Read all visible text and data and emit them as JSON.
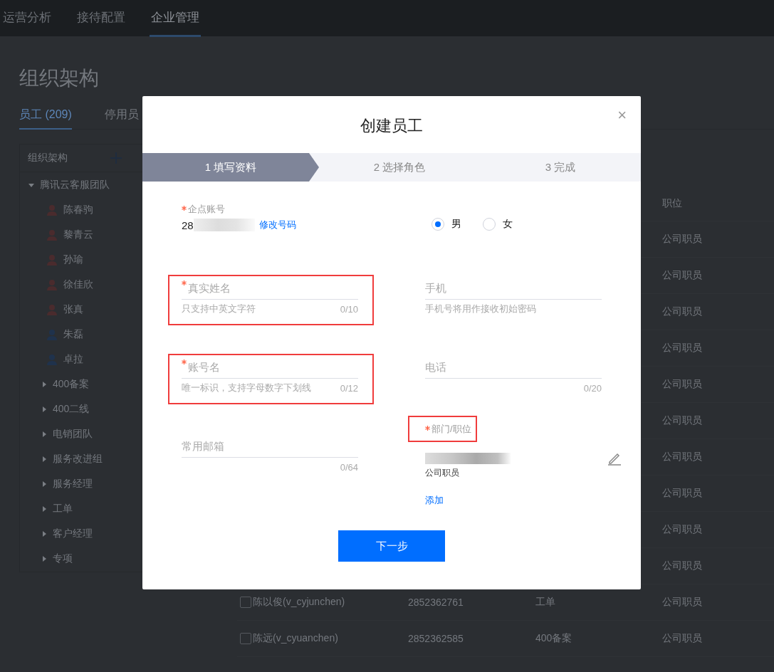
{
  "top_nav": {
    "items": [
      {
        "label": "运营分析",
        "selected": false
      },
      {
        "label": "接待配置",
        "selected": false
      },
      {
        "label": "企业管理",
        "selected": true
      }
    ]
  },
  "page_title": "组织架构",
  "tabs": [
    {
      "label": "员工 (209)",
      "selected": true
    },
    {
      "label": "停用员",
      "selected": false
    }
  ],
  "tree": {
    "header": "组织架构",
    "items": [
      {
        "label": "腾讯云客服团队",
        "expanded": true,
        "children": [
          {
            "kind": "person",
            "label": "陈春驹",
            "color": "#4a2b2d"
          },
          {
            "kind": "person",
            "label": "黎青云",
            "color": "#4a2b2d"
          },
          {
            "kind": "person",
            "label": "孙瑜",
            "color": "#4a2b2d"
          },
          {
            "kind": "person",
            "label": "徐佳欣",
            "color": "#4a2b2d"
          },
          {
            "kind": "person",
            "label": "张真",
            "color": "#4a2b2d"
          },
          {
            "kind": "person",
            "label": "朱磊",
            "color": "#1f324c"
          },
          {
            "kind": "person",
            "label": "卓拉",
            "color": "#1f324c"
          },
          {
            "kind": "group",
            "label": "400备案",
            "expanded": false
          },
          {
            "kind": "group",
            "label": "400二线",
            "expanded": false
          },
          {
            "kind": "group",
            "label": "电销团队",
            "expanded": false
          },
          {
            "kind": "group",
            "label": "服务改进组",
            "expanded": false
          },
          {
            "kind": "group",
            "label": "服务经理",
            "expanded": false
          },
          {
            "kind": "group",
            "label": "工单",
            "expanded": false
          },
          {
            "kind": "group",
            "label": "客户经理",
            "expanded": false
          },
          {
            "kind": "group",
            "label": "专项",
            "expanded": false
          }
        ]
      }
    ]
  },
  "table": {
    "position_header": "职位",
    "rows": [
      {
        "position": "公司职员"
      },
      {
        "position": "公司职员"
      },
      {
        "position": "公司职员"
      },
      {
        "position": "公司职员"
      },
      {
        "position": "公司职员"
      },
      {
        "position": "公司职员"
      },
      {
        "position": "公司职员"
      },
      {
        "position": "公司职员"
      },
      {
        "position": "公司职员"
      },
      {
        "position": "公司职员"
      },
      {
        "checked": false,
        "name": "陈以俊(v_cyjunchen)",
        "account": "2852362761",
        "department": "工单",
        "position": "公司职员"
      },
      {
        "checked": false,
        "name": "陈远(v_cyuanchen)",
        "account": "2852362585",
        "department": "400备案",
        "position": "公司职员"
      }
    ]
  },
  "dialog": {
    "title": "创建员工",
    "close": "×",
    "steps": [
      {
        "label": "1 填写资料",
        "selected": true
      },
      {
        "label": "2 选择角色",
        "selected": false
      },
      {
        "label": "3 完成",
        "selected": false
      }
    ],
    "account": {
      "label": "企点账号",
      "required": true,
      "value": "28",
      "action": "修改号码"
    },
    "gender": [
      {
        "label": "男",
        "selected": true
      },
      {
        "label": "女",
        "selected": false
      }
    ],
    "columns": [
      {
        "items": [
          {
            "kind": "text-field",
            "label": "真实姓名",
            "required": true,
            "highlighted": true,
            "hint": "只支持中英文字符",
            "count": "0/10"
          },
          {
            "kind": "text-field",
            "label": "账号名",
            "required": true,
            "highlighted": true,
            "hint": "唯一标识，支持字母数字下划线",
            "count": "0/12"
          },
          {
            "kind": "text-field",
            "label": "常用邮箱",
            "required": false,
            "highlighted": false,
            "count": "0/64"
          }
        ]
      },
      {
        "items": [
          {
            "kind": "text-field",
            "label": "手机",
            "required": false,
            "highlighted": false,
            "hint": "手机号将用作接收初始密码"
          },
          {
            "kind": "text-field",
            "label": "电话",
            "required": false,
            "highlighted": false,
            "count": "0/20"
          },
          {
            "kind": "department",
            "label": "部门/职位",
            "required": true,
            "highlighted": true,
            "position": "公司职员",
            "action": "添加"
          }
        ]
      }
    ],
    "next_button": "下一步"
  }
}
